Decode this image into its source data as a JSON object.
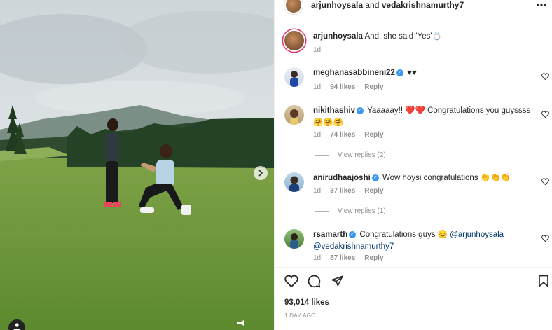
{
  "post": {
    "header": {
      "author": "arjunhoysala",
      "connector": " and ",
      "coauthor": "vedakrishnamurthy7"
    },
    "caption": {
      "username": "arjunhoysala",
      "text": "And, she said 'Yes'💍",
      "time": "1d"
    },
    "comments": [
      {
        "username": "meghanasabbineni22",
        "verified": true,
        "text": "♥♥",
        "time": "1d",
        "likes": "94 likes",
        "reply": "Reply",
        "view_replies": ""
      },
      {
        "username": "nikithashiv",
        "verified": true,
        "text": "Yaaaaay!! ❤️❤️ Congratulations you guyssss 🤗🤗🤗",
        "time": "1d",
        "likes": "74 likes",
        "reply": "Reply",
        "view_replies": "View replies (2)"
      },
      {
        "username": "anirudhaajoshi",
        "verified": true,
        "text": "Wow hoysi congratulations 👏👏👏",
        "time": "1d",
        "likes": "37 likes",
        "reply": "Reply",
        "view_replies": "View replies (1)"
      },
      {
        "username": "rsamarth",
        "verified": true,
        "text_pre": "Congratulations guys 😊 ",
        "mention1": "@arjunhoysala",
        "mention2": "@vedakrishnamurthy7",
        "time": "1d",
        "likes": "87 likes",
        "reply": "Reply",
        "view_replies": ""
      }
    ],
    "likes_count": "93,014 likes",
    "date": "1 DAY AGO"
  },
  "icons": {
    "more": "more-horizontal-icon",
    "heart": "heart-icon",
    "comment": "comment-icon",
    "share": "share-icon",
    "save": "bookmark-icon",
    "next": "chevron-right-icon",
    "tag": "user-tag-icon",
    "sound": "speaker-icon"
  },
  "colors": {
    "verified": "#3897f0",
    "story_ring": "#e1306c",
    "link": "#00376b"
  }
}
